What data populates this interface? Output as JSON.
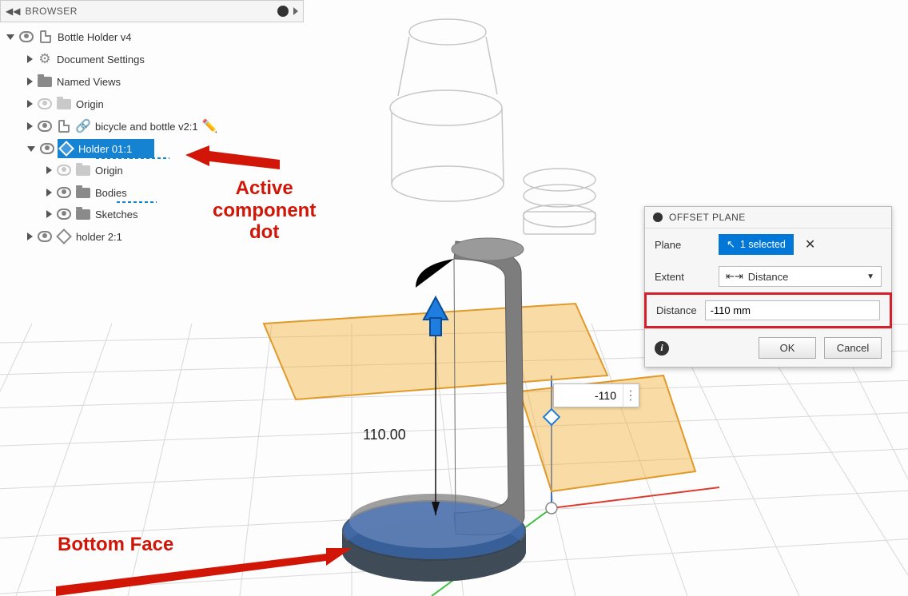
{
  "browser": {
    "title": "BROWSER",
    "root": "Bottle Holder v4",
    "items": {
      "doc_settings": "Document Settings",
      "named_views": "Named Views",
      "origin": "Origin",
      "linked": "bicycle and bottle v2:1",
      "holder01": "Holder 01:1",
      "holder01_origin": "Origin",
      "holder01_bodies": "Bodies",
      "holder01_sketches": "Sketches",
      "holder2": "holder 2:1"
    }
  },
  "dialog": {
    "title": "OFFSET PLANE",
    "plane_label": "Plane",
    "plane_value": "1 selected",
    "extent_label": "Extent",
    "extent_value": "Distance",
    "distance_label": "Distance",
    "distance_value": "-110 mm",
    "ok": "OK",
    "cancel": "Cancel"
  },
  "viewport": {
    "dim_label": "110.00",
    "float_value": "-110"
  },
  "annotations": {
    "active_dot_l1": "Active",
    "active_dot_l2": "component",
    "active_dot_l3": "dot",
    "bottom_face": "Bottom Face"
  }
}
